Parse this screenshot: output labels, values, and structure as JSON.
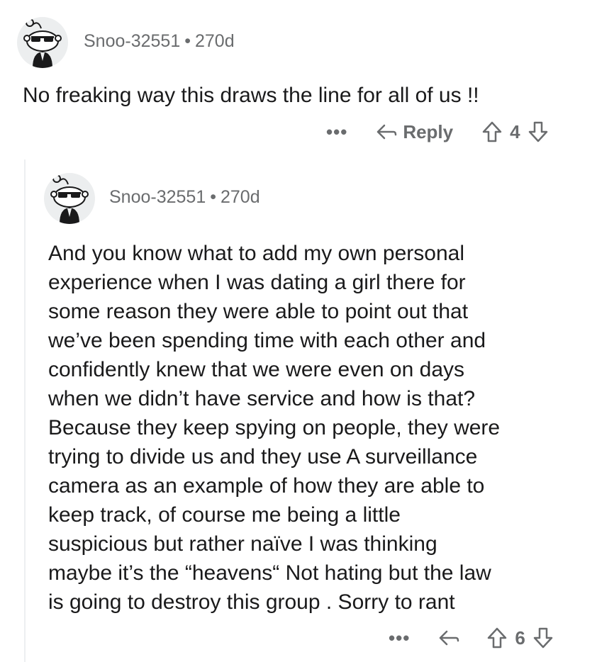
{
  "comments": [
    {
      "username": "Snoo-32551",
      "separator": "•",
      "age": "270d",
      "body": "No freaking way this draws the line for all of us !!",
      "more": "•••",
      "reply_label": "Reply",
      "score": "4"
    },
    {
      "username": "Snoo-32551",
      "separator": "•",
      "age": "270d",
      "body_lines": [
        "And you know what to add my own personal",
        "experience when I was dating a girl there for",
        "some reason they were able to point out that",
        "we’ve been spending time with each other  and",
        "confidently knew that we were even on days",
        "when we didn’t have service and how is that?",
        "Because they keep spying on people, they were",
        "trying to divide us and they use A surveillance",
        "camera as an example of how they are able to",
        "keep track, of course me being a little",
        "suspicious but rather naïve I was thinking",
        "maybe it’s the “heavens“ Not hating but the law",
        "is going to destroy this group . Sorry to rant"
      ],
      "more": "•••",
      "score": "6"
    }
  ],
  "colors": {
    "text": "#1a1a1b",
    "meta": "#6a6c6e",
    "avatar_bg": "#eceeef",
    "thread": "#edeff1"
  },
  "icons": [
    "snoo-avatar-icon",
    "more-options-icon",
    "reply-arrow-icon",
    "upvote-icon",
    "downvote-icon"
  ]
}
